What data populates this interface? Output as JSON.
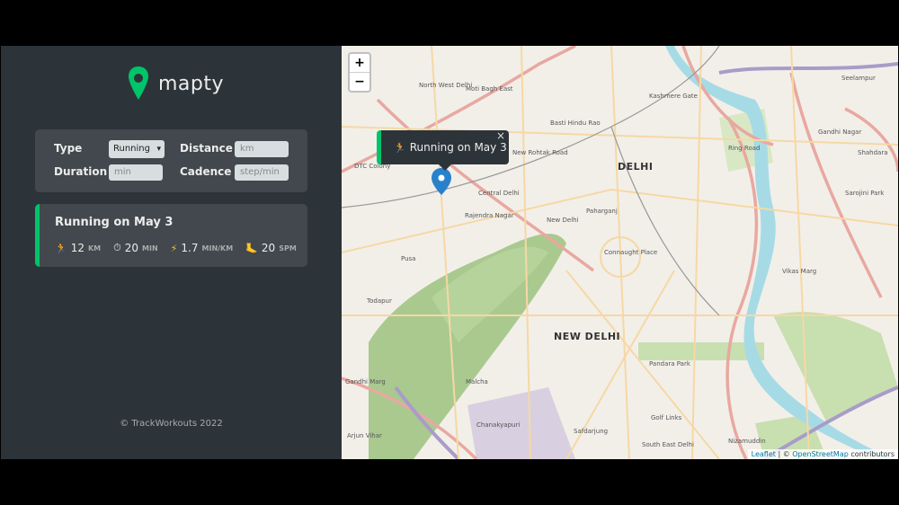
{
  "app": {
    "logo_text": "mapty",
    "copyright": "© TrackWorkouts 2022"
  },
  "form": {
    "type_label": "Type",
    "type_value": "Running",
    "distance_label": "Distance",
    "distance_placeholder": "km",
    "duration_label": "Duration",
    "duration_placeholder": "min",
    "cadence_label": "Cadence",
    "cadence_placeholder": "step/min"
  },
  "workouts": [
    {
      "title": "Running on May 3",
      "distance": "12",
      "distance_unit": "KM",
      "duration": "20",
      "duration_unit": "MIN",
      "pace": "1.7",
      "pace_unit": "MIN/KM",
      "cadence": "20",
      "cadence_unit": "SPM",
      "icons": {
        "distance": "runner-icon",
        "duration": "stopwatch-icon",
        "pace": "lightning-icon",
        "cadence": "footprint-icon"
      }
    }
  ],
  "map": {
    "zoom_in": "+",
    "zoom_out": "−",
    "popup_text": "Running on May 3",
    "popup_close": "×",
    "attribution_leaflet": "Leaflet",
    "attribution_sep": " | © ",
    "attribution_osm": "OpenStreetMap",
    "attribution_tail": " contributors",
    "labels": [
      "DELHI",
      "NEW DELHI",
      "Moti Bagh East",
      "Kashmere Gate",
      "Basti Hindu Rao",
      "DTC Colony",
      "Rajendra Nagar",
      "Central Delhi",
      "New Delhi",
      "Paharganj",
      "Connaught Place",
      "Pusa",
      "Todapur",
      "Gandhi Marg",
      "Malcha",
      "Chanakyapuri",
      "Pandara Park",
      "Golf Links",
      "Safdarjung",
      "South East Delhi",
      "Nizamuddin",
      "Vikas Marg",
      "Shahdara",
      "Gandhi Nagar",
      "Seelampur",
      "Arjun Vihar",
      "Sarojini Park",
      "Ring Road",
      "New Rohtak Road",
      "North West Delhi"
    ],
    "colors": {
      "land": "#f2efe9",
      "park": "#c8dfb0",
      "forest": "#a9c98f",
      "river": "#a6dbe6",
      "major_road": "#e8a8a0",
      "secondary_road": "#f6d8a4",
      "marker": "#2a81cb",
      "accent": "#00c46a"
    }
  }
}
